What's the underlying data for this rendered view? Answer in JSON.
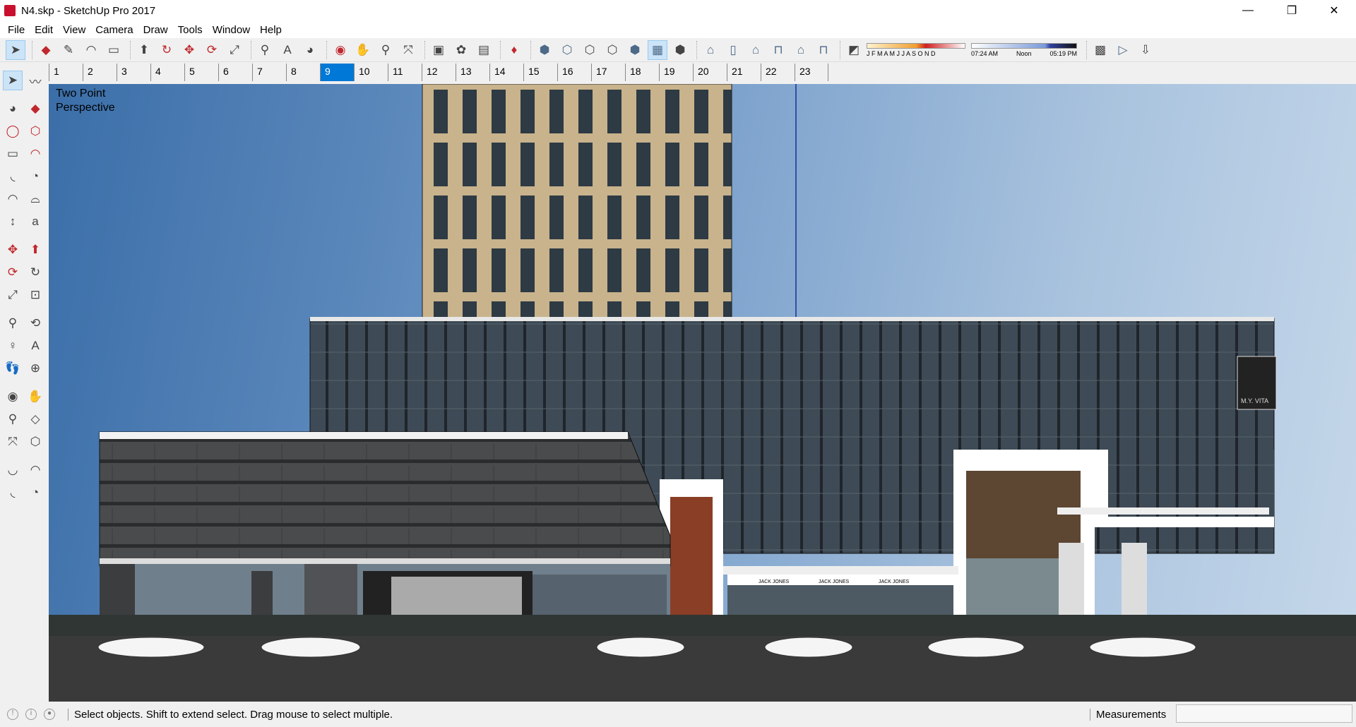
{
  "window": {
    "title": "N4.skp - SketchUp Pro 2017",
    "minimize": "—",
    "restore": "❐",
    "close": "✕"
  },
  "menu": [
    "File",
    "Edit",
    "View",
    "Camera",
    "Draw",
    "Tools",
    "Window",
    "Help"
  ],
  "toolbar": {
    "icons": [
      "select-icon",
      "eraser-icon",
      "pencil-icon",
      "arc-icon",
      "rectangle-icon",
      "push-pull-icon",
      "follow-me-icon",
      "move-icon",
      "rotate-icon",
      "scale-icon",
      "tape-measure-icon",
      "text-icon",
      "paint-bucket-icon",
      "orbit-icon",
      "pan-icon",
      "zoom-icon",
      "zoom-extents-icon",
      "warehouse-icon",
      "extension-warehouse-icon",
      "layout-icon",
      "ruby-icon",
      "xray-icon",
      "back-edges-icon",
      "wireframe-icon",
      "hidden-line-icon",
      "shaded-icon",
      "shaded-textures-icon",
      "monochrome-icon",
      "iso-view-icon",
      "top-view-icon",
      "front-view-icon",
      "right-view-icon",
      "back-view-icon",
      "left-view-icon",
      "shadows-toggle-icon",
      "geolocation-icon",
      "preview-icon",
      "photo-textures-icon"
    ],
    "shadow": {
      "months": "J F M A M J J A S O N D",
      "time_start": "07:24 AM",
      "time_mid": "Noon",
      "time_end": "05:19 PM"
    }
  },
  "scenes": {
    "tabs": [
      "1",
      "2",
      "3",
      "4",
      "5",
      "6",
      "7",
      "8",
      "9",
      "10",
      "11",
      "12",
      "13",
      "14",
      "15",
      "16",
      "17",
      "18",
      "19",
      "20",
      "21",
      "22",
      "23"
    ],
    "selected": "9"
  },
  "left_toolbar": [
    "select-icon",
    "make-component-icon",
    "paint-bucket-icon",
    "eraser-icon",
    "line-icon",
    "freehand-icon",
    "rectangle-icon",
    "rotated-rectangle-icon",
    "circle-icon",
    "polygon-icon",
    "arc-icon",
    "two-point-arc-icon",
    "three-point-arc-icon",
    "pie-icon",
    "move-icon",
    "push-pull-icon",
    "rotate-icon",
    "follow-me-icon",
    "scale-icon",
    "offset-icon",
    "tape-measure-icon",
    "dimension-icon",
    "protractor-icon",
    "text-icon",
    "axes-icon",
    "3d-text-icon",
    "orbit-icon",
    "pan-icon",
    "zoom-icon",
    "zoom-window-icon",
    "zoom-extents-icon",
    "previous-view-icon",
    "position-camera-icon",
    "look-around-icon",
    "walk-icon",
    "section-plane-icon"
  ],
  "viewport": {
    "label": "Two Point\nPerspective",
    "sign": "M.Y. VITA",
    "shop": "JACK JONES"
  },
  "status": {
    "message": "Select objects. Shift to extend select. Drag mouse to select multiple.",
    "measurements_label": "Measurements",
    "measurements_value": ""
  },
  "colors": {
    "accent": "#0078d7",
    "sky": "#6f98c7",
    "facade": "#3d4650"
  }
}
